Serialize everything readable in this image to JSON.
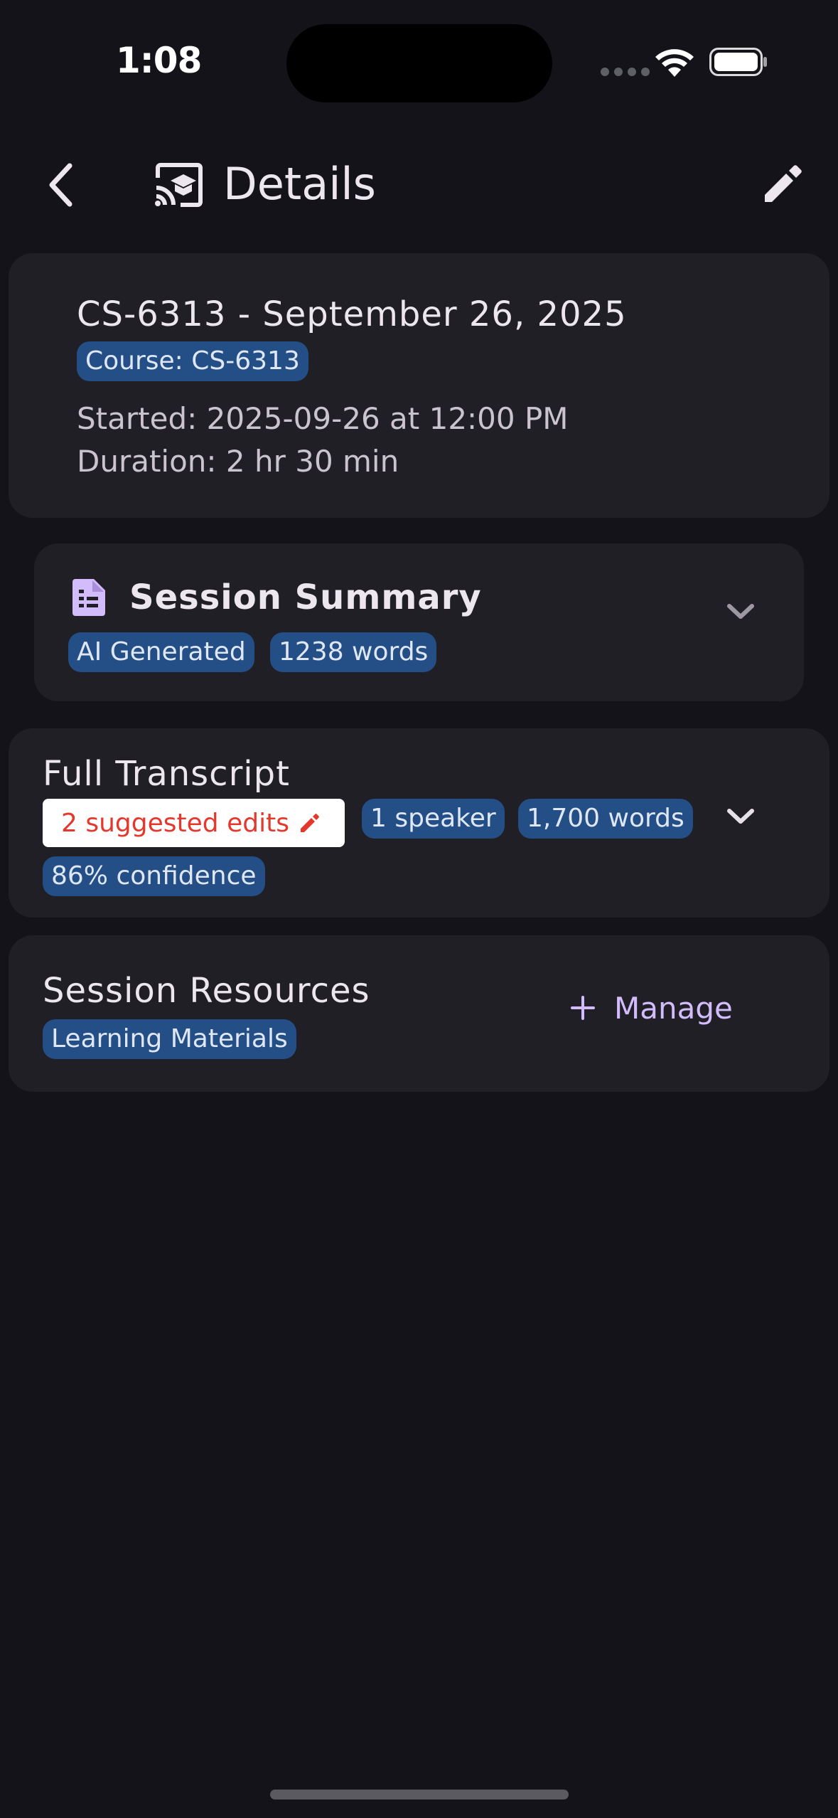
{
  "status_bar": {
    "time": "1:08"
  },
  "app_bar": {
    "title": "Details",
    "icons": {
      "back": "chevron-left-icon",
      "title": "cast-for-education-icon",
      "edit": "pencil-icon"
    }
  },
  "session": {
    "title": "CS-6313 - September 26, 2025",
    "course_chip": "Course: CS-6313",
    "started": "Started: 2025-09-26 at 12:00 PM",
    "duration": "Duration: 2 hr 30 min"
  },
  "summary": {
    "title": "Session Summary",
    "chips": [
      "AI Generated",
      "1238 words"
    ]
  },
  "transcript": {
    "title": "Full Transcript",
    "edits_label": "2 suggested edits",
    "chips": [
      "1 speaker",
      "1,700 words",
      "86% confidence"
    ]
  },
  "resources": {
    "title": "Session Resources",
    "chip": "Learning Materials",
    "manage_label": "Manage"
  },
  "colors": {
    "background": "#15131a",
    "card": "#211f26",
    "chip": "#234e86",
    "accent": "#d3bcfc",
    "warning": "#e5382d"
  }
}
